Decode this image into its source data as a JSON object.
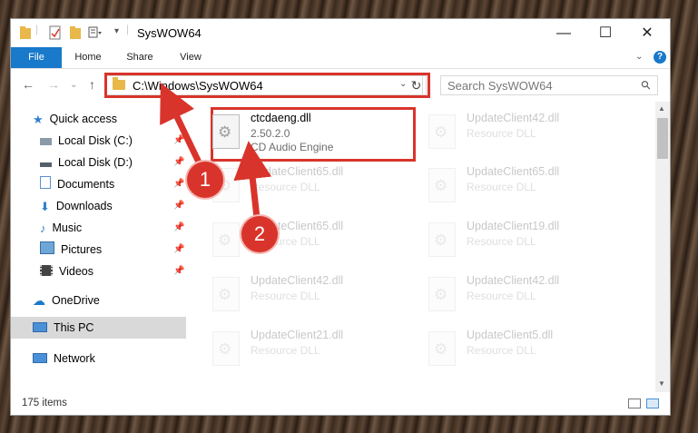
{
  "window": {
    "title": "SysWOW64",
    "min_glyph": "—",
    "max_glyph": "☐",
    "close_glyph": "✕"
  },
  "ribbon": {
    "file": "File",
    "home": "Home",
    "share": "Share",
    "view": "View",
    "help_glyph": "?"
  },
  "nav": {
    "back_glyph": "←",
    "forward_glyph": "→",
    "up_glyph": "↑",
    "recent_glyph": "⌄",
    "address": "C:\\Windows\\SysWOW64",
    "refresh_glyph": "↻",
    "search_placeholder": "Search SysWOW64",
    "search_glyph": "⚲"
  },
  "sidebar": {
    "items": [
      {
        "label": "Quick access",
        "icon": "star-icon"
      },
      {
        "label": "Local Disk (C:)",
        "icon": "drive-icon",
        "pinned": true
      },
      {
        "label": "Local Disk (D:)",
        "icon": "drive-icon",
        "pinned": true
      },
      {
        "label": "Documents",
        "icon": "documents-icon",
        "pinned": true
      },
      {
        "label": "Downloads",
        "icon": "downloads-icon",
        "pinned": true
      },
      {
        "label": "Music",
        "icon": "music-icon",
        "pinned": true
      },
      {
        "label": "Pictures",
        "icon": "pictures-icon",
        "pinned": true
      },
      {
        "label": "Videos",
        "icon": "videos-icon",
        "pinned": true
      },
      {
        "label": "OneDrive",
        "icon": "cloud-icon"
      },
      {
        "label": "This PC",
        "icon": "computer-icon",
        "selected": true
      },
      {
        "label": "Network",
        "icon": "network-icon"
      }
    ],
    "pin_glyph": "📌"
  },
  "files": [
    {
      "name": "ctcdaeng.dll",
      "version": "2.50.2.0",
      "description": "CD Audio Engine"
    },
    {
      "name": "UpdateClient42.dll",
      "description": "Resource DLL"
    },
    {
      "name": "UpdateClient65.dll",
      "description": "Resource DLL"
    },
    {
      "name": "UpdateClient65.dll",
      "description": "Resource DLL"
    },
    {
      "name": "UpdateClient65.dll",
      "description": "Resource DLL"
    },
    {
      "name": "UpdateClient19.dll",
      "description": "Resource DLL"
    },
    {
      "name": "UpdateClient42.dll",
      "description": "Resource DLL"
    },
    {
      "name": "UpdateClient42.dll",
      "description": "Resource DLL"
    },
    {
      "name": "UpdateClient21.dll",
      "description": "Resource DLL"
    },
    {
      "name": "UpdateClient5.dll",
      "description": "Resource DLL"
    }
  ],
  "status": {
    "item_count": "175 items"
  },
  "annotations": {
    "step1": "1",
    "step2": "2",
    "color": "#d9342b"
  }
}
